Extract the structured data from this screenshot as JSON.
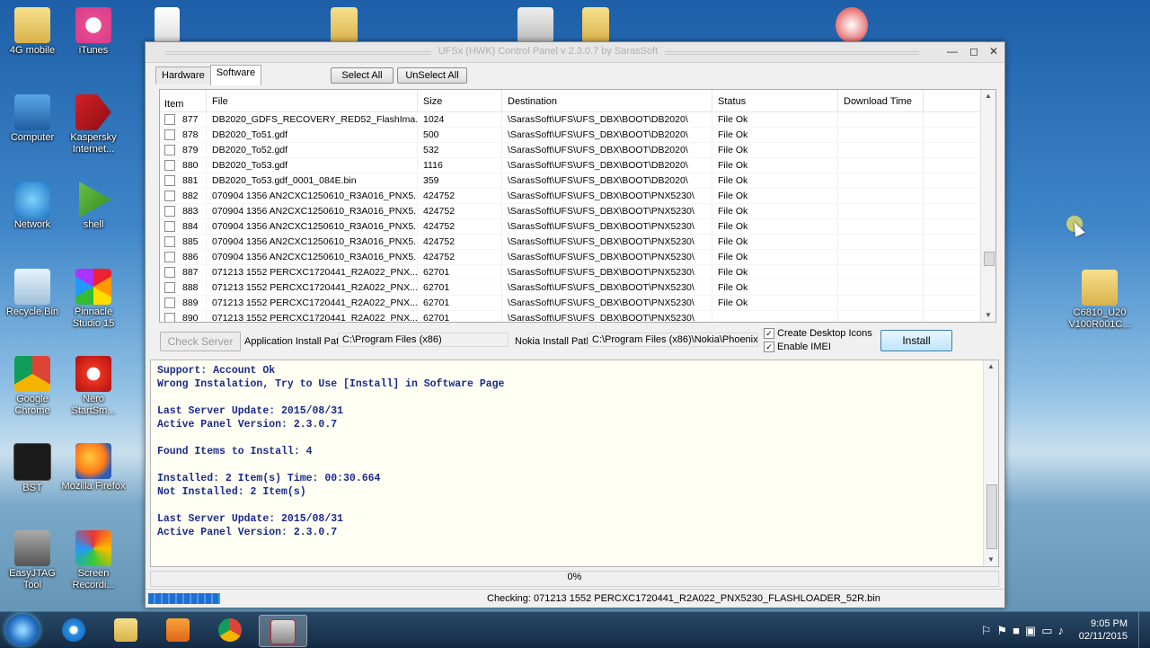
{
  "desktop": {
    "icons": [
      {
        "label": "4G mobile",
        "icon": "folder-icon"
      },
      {
        "label": "iTunes",
        "icon": "itunes-icon"
      },
      {
        "label": "Computer",
        "icon": "computer-icon"
      },
      {
        "label": "Kaspersky Internet...",
        "icon": "kaspersky-icon"
      },
      {
        "label": "Network",
        "icon": "network-icon"
      },
      {
        "label": "shell",
        "icon": "shell-icon"
      },
      {
        "label": "Recycle Bin",
        "icon": "recycle-bin-icon"
      },
      {
        "label": "Pinnacle Studio 15",
        "icon": "pinnacle-icon"
      },
      {
        "label": "Google Chrome",
        "icon": "chrome-icon"
      },
      {
        "label": "Nero StartSm...",
        "icon": "nero-icon"
      },
      {
        "label": "BST",
        "icon": "bst-icon"
      },
      {
        "label": "Mozilla Firefox",
        "icon": "firefox-icon"
      },
      {
        "label": "EasyJTAG Tool",
        "icon": "easyjtag-icon"
      },
      {
        "label": "Screen Recordi...",
        "icon": "screen-recorder-icon"
      },
      {
        "label": "C6810_U20 V100R001C...",
        "icon": "folder-icon"
      }
    ]
  },
  "window": {
    "title": "UFSx (HWK) Control Panel v 2.3.0.7 by SarasSoft",
    "tabs": [
      {
        "label": "Hardware"
      },
      {
        "label": "Software"
      }
    ],
    "select_all": "Select All",
    "unselect_all": "UnSelect All",
    "columns": [
      "Item",
      "File",
      "Size",
      "Destination",
      "Status",
      "Download Time"
    ],
    "rows": [
      {
        "item": "877",
        "file": "DB2020_GDFS_RECOVERY_RED52_FlashIma...",
        "size": "1024",
        "dest": "\\SarasSoft\\UFS\\UFS_DBX\\BOOT\\DB2020\\",
        "status": "File Ok",
        "dl": ""
      },
      {
        "item": "878",
        "file": "DB2020_To51.gdf",
        "size": "500",
        "dest": "\\SarasSoft\\UFS\\UFS_DBX\\BOOT\\DB2020\\",
        "status": "File Ok",
        "dl": ""
      },
      {
        "item": "879",
        "file": "DB2020_To52.gdf",
        "size": "532",
        "dest": "\\SarasSoft\\UFS\\UFS_DBX\\BOOT\\DB2020\\",
        "status": "File Ok",
        "dl": ""
      },
      {
        "item": "880",
        "file": "DB2020_To53.gdf",
        "size": "1116",
        "dest": "\\SarasSoft\\UFS\\UFS_DBX\\BOOT\\DB2020\\",
        "status": "File Ok",
        "dl": ""
      },
      {
        "item": "881",
        "file": "DB2020_To53.gdf_0001_084E.bin",
        "size": "359",
        "dest": "\\SarasSoft\\UFS\\UFS_DBX\\BOOT\\DB2020\\",
        "status": "File Ok",
        "dl": ""
      },
      {
        "item": "882",
        "file": "070904 1356 AN2CXC1250610_R3A016_PNX5...",
        "size": "424752",
        "dest": "\\SarasSoft\\UFS\\UFS_DBX\\BOOT\\PNX5230\\",
        "status": "File Ok",
        "dl": ""
      },
      {
        "item": "883",
        "file": "070904 1356 AN2CXC1250610_R3A016_PNX5...",
        "size": "424752",
        "dest": "\\SarasSoft\\UFS\\UFS_DBX\\BOOT\\PNX5230\\",
        "status": "File Ok",
        "dl": ""
      },
      {
        "item": "884",
        "file": "070904 1356 AN2CXC1250610_R3A016_PNX5...",
        "size": "424752",
        "dest": "\\SarasSoft\\UFS\\UFS_DBX\\BOOT\\PNX5230\\",
        "status": "File Ok",
        "dl": ""
      },
      {
        "item": "885",
        "file": "070904 1356 AN2CXC1250610_R3A016_PNX5...",
        "size": "424752",
        "dest": "\\SarasSoft\\UFS\\UFS_DBX\\BOOT\\PNX5230\\",
        "status": "File Ok",
        "dl": ""
      },
      {
        "item": "886",
        "file": "070904 1356 AN2CXC1250610_R3A016_PNX5...",
        "size": "424752",
        "dest": "\\SarasSoft\\UFS\\UFS_DBX\\BOOT\\PNX5230\\",
        "status": "File Ok",
        "dl": ""
      },
      {
        "item": "887",
        "file": "071213 1552 PERCXC1720441_R2A022_PNX...",
        "size": "62701",
        "dest": "\\SarasSoft\\UFS\\UFS_DBX\\BOOT\\PNX5230\\",
        "status": "File Ok",
        "dl": ""
      },
      {
        "item": "888",
        "file": "071213 1552 PERCXC1720441_R2A022_PNX...",
        "size": "62701",
        "dest": "\\SarasSoft\\UFS\\UFS_DBX\\BOOT\\PNX5230\\",
        "status": "File Ok",
        "dl": ""
      },
      {
        "item": "889",
        "file": "071213 1552 PERCXC1720441_R2A022_PNX...",
        "size": "62701",
        "dest": "\\SarasSoft\\UFS\\UFS_DBX\\BOOT\\PNX5230\\",
        "status": "File Ok",
        "dl": ""
      },
      {
        "item": "890",
        "file": "071213 1552 PERCXC1720441_R2A022_PNX...",
        "size": "62701",
        "dest": "\\SarasSoft\\UFS\\UFS_DBX\\BOOT\\PNX5230\\",
        "status": "",
        "dl": ""
      }
    ],
    "check_server": "Check Server",
    "app_install_path_label": "Application Install Path",
    "app_install_path": "C:\\Program Files (x86)",
    "nokia_install_path_label": "Nokia Install Path",
    "nokia_install_path": "C:\\Program Files (x86)\\Nokia\\Phoenix",
    "create_desktop_icons": "Create Desktop Icons",
    "enable_imei": "Enable IMEI",
    "install": "Install",
    "log": "Support: Account Ok\nWrong Instalation, Try to Use [Install] in Software Page\n\nLast Server Update: 2015/08/31\nActive Panel Version: 2.3.0.7\n\nFound Items to Install: 4\n\nInstalled: 2 Item(s) Time: 00:30.664\nNot Installed: 2 Item(s)\n\nLast Server Update: 2015/08/31\nActive Panel Version: 2.3.0.7",
    "progress": "0%",
    "status": "Checking: 071213 1552 PERCXC1720441_R2A022_PNX5230_FLASHLOADER_52R.bin"
  },
  "taskbar": {
    "clock_time": "9:05 PM",
    "clock_date": "02/11/2015"
  }
}
